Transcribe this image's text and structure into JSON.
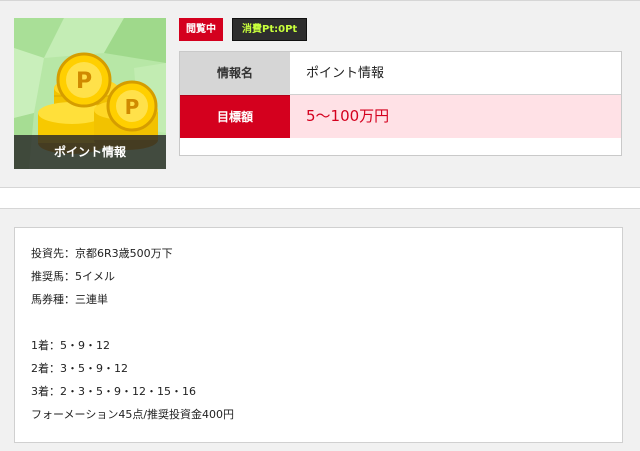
{
  "thumbnail": {
    "caption": "ポイント情報"
  },
  "badges": {
    "status": "閲覧中",
    "points": "消費Pt:0Pt"
  },
  "info": {
    "name_label": "情報名",
    "name_value": "ポイント情報",
    "target_label": "目標額",
    "target_value": "5〜100万円"
  },
  "details": {
    "lines": [
      "投資先：京都6R3歳500万下",
      "推奨馬：5イメル",
      "馬券種：三連単",
      "",
      "1着：5・9・12",
      "2着：3・5・9・12",
      "3着：2・3・5・9・12・15・16",
      "フォーメーション45点/推奨投資金400円"
    ]
  },
  "colors": {
    "accent_red": "#d4001e",
    "pink_bg": "#ffe1e6",
    "points_text": "#c8ff3c"
  },
  "icons": {
    "thumbnail_art": "stacked-gold-p-coins-icon"
  }
}
